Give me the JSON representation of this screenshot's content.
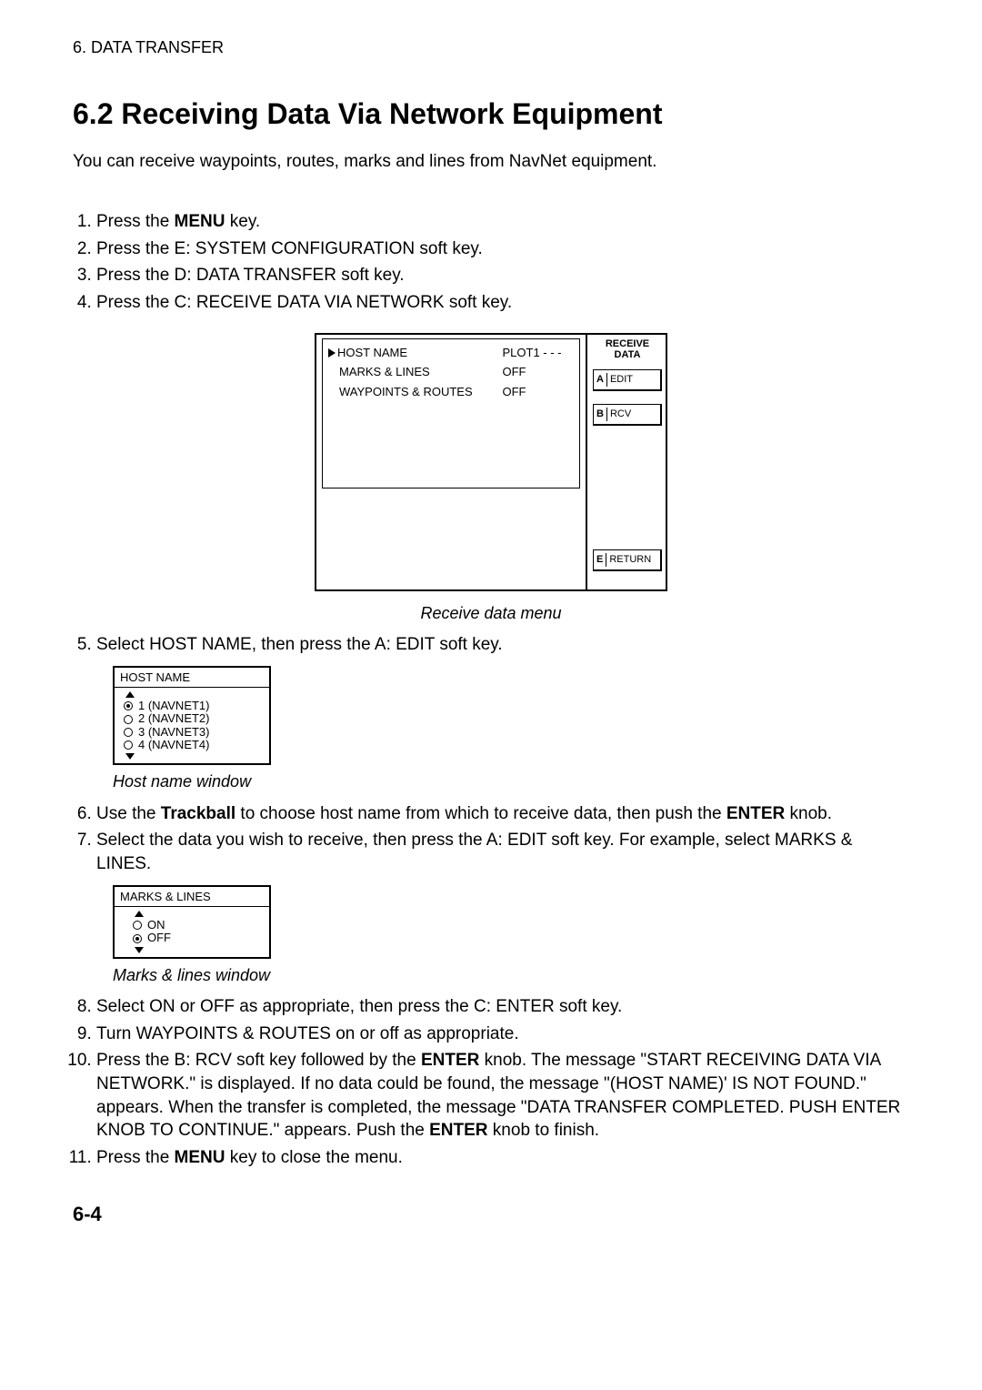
{
  "header": "6.  DATA  TRANSFER",
  "section_title": "6.2    Receiving Data Via Network Equipment",
  "intro": "You can receive waypoints, routes, marks and lines from NavNet equipment.",
  "steps": {
    "s1_a": "Press the ",
    "s1_b": "MENU",
    "s1_c": " key.",
    "s2": "Press the E: SYSTEM CONFIGURATION soft key.",
    "s3": "Press the D: DATA TRANSFER soft key.",
    "s4": "Press the C: RECEIVE DATA VIA NETWORK soft key.",
    "s5": "Select HOST NAME, then press the A: EDIT soft key.",
    "s6_a": "Use the ",
    "s6_b": "Trackball",
    "s6_c": " to choose host name from which to receive data, then push the ",
    "s6_d": "ENTER",
    "s6_e": " knob.",
    "s7": "Select the data you wish to receive, then press the A: EDIT soft key. For example, select MARKS & LINES.",
    "s8": "Select ON or OFF as appropriate, then press the C: ENTER soft key.",
    "s9": "Turn WAYPOINTS & ROUTES on or off as appropriate.",
    "s10_a": "Press the B: RCV soft key followed by the ",
    "s10_b": "ENTER",
    "s10_c": " knob. The message \"START RECEIVING DATA VIA NETWORK.\" is displayed. If no data could be found, the message \"(HOST NAME)' IS NOT FOUND.\" appears. When the transfer is completed, the message \"DATA TRANSFER COMPLETED. PUSH ENTER KNOB TO CONTINUE.\" appears. Push the ",
    "s10_d": "ENTER",
    "s10_e": " knob to finish.",
    "s11_a": "Press the ",
    "s11_b": "MENU",
    "s11_c": " key to close the menu."
  },
  "fig_menu": {
    "rows": [
      {
        "label": "HOST NAME",
        "value": "PLOT1 - - -"
      },
      {
        "label": "MARKS & LINES",
        "value": "OFF"
      },
      {
        "label": "WAYPOINTS & ROUTES",
        "value": "OFF"
      }
    ],
    "title_line1": "RECEIVE",
    "title_line2": "DATA",
    "softkeys": {
      "a": {
        "letter": "A",
        "label": "EDIT"
      },
      "b": {
        "letter": "B",
        "label": "RCV"
      },
      "e": {
        "letter": "E",
        "label": "RETURN"
      }
    },
    "caption": "Receive data menu"
  },
  "host_window": {
    "title": "HOST NAME",
    "items": [
      {
        "label": "1 (NAVNET1)",
        "selected": true
      },
      {
        "label": "2 (NAVNET2)",
        "selected": false
      },
      {
        "label": "3 (NAVNET3)",
        "selected": false
      },
      {
        "label": "4 (NAVNET4)",
        "selected": false
      }
    ],
    "caption": "Host name window"
  },
  "marks_window": {
    "title": "MARKS & LINES",
    "items": [
      {
        "label": "ON",
        "selected": false
      },
      {
        "label": "OFF",
        "selected": true
      }
    ],
    "caption": "Marks & lines window"
  },
  "page_num": "6-4"
}
